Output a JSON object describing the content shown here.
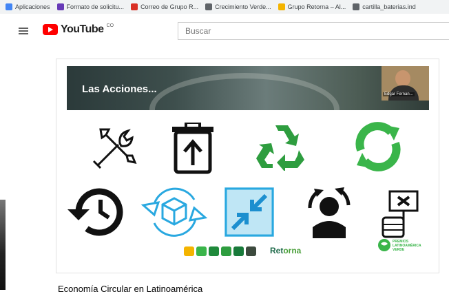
{
  "bookmarks": [
    {
      "label": "Aplicaciones",
      "icon": "apps-grid-icon",
      "color": "#4285f4"
    },
    {
      "label": "Formato de solicitu...",
      "icon": "forms-icon",
      "color": "#673ab7"
    },
    {
      "label": "Correo de Grupo R...",
      "icon": "gmail-icon",
      "color": "#d93025"
    },
    {
      "label": "Crecimiento Verde...",
      "icon": "globe-icon",
      "color": "#5f6368"
    },
    {
      "label": "Grupo Retorna – Al...",
      "icon": "retorna-favicon-icon",
      "color": "#f4b400"
    },
    {
      "label": "cartilla_baterias.ind",
      "icon": "globe-icon",
      "color": "#5f6368"
    }
  ],
  "header": {
    "logo_text": "YouTube",
    "country": "CO",
    "search_placeholder": "Buscar"
  },
  "slide": {
    "title": "Las Acciones...",
    "presenter_name": "Edgar Fernan...",
    "brand_name_part1": "Ret",
    "brand_name_part2": "orna",
    "award_text": "PREMIOS LATINOAMÉRICA VERDE"
  },
  "colors": {
    "youtube_red": "#ff0000",
    "recycle_green": "#2e9d3f",
    "cycle_green": "#3ab54a",
    "box_blue": "#29a8e0",
    "retorna_green": "#1f6b4b"
  },
  "video_title": "Economía Circular en Latinoamérica"
}
